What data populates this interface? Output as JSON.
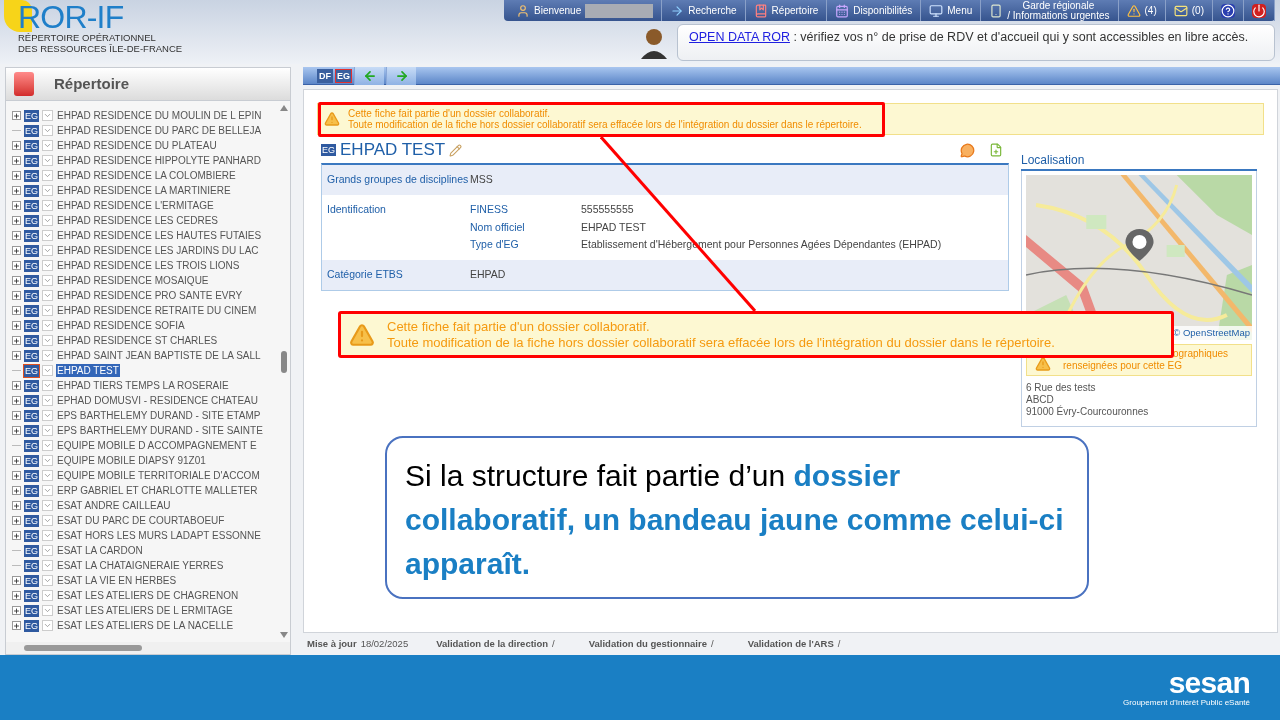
{
  "header": {
    "logo": "ROR-IF",
    "subtitle_lines": [
      "RÉPERTOIRE OPÉRATIONNEL",
      "DES RESSOURCES ÎLE-DE-FRANCE"
    ]
  },
  "nav": [
    {
      "kind": "user",
      "lines": [
        "Bienvenue"
      ]
    },
    {
      "kind": "search",
      "lines": [
        "Recherche"
      ]
    },
    {
      "kind": "directory",
      "lines": [
        "Répertoire"
      ]
    },
    {
      "kind": "availability",
      "lines": [
        "Disponibilités"
      ]
    },
    {
      "kind": "menu",
      "lines": [
        "Menu"
      ]
    },
    {
      "kind": "guard",
      "lines": [
        "Garde régionale",
        "/ Informations urgentes"
      ]
    },
    {
      "kind": "alert",
      "lines": [
        "(4)"
      ]
    },
    {
      "kind": "mail",
      "lines": [
        "(0)"
      ]
    },
    {
      "kind": "help"
    },
    {
      "kind": "power"
    }
  ],
  "notice": {
    "link": "OPEN DATA ROR",
    "text": " : vérifiez vos n° de prise de RDV et d'accueil qui y sont accessibles en libre accès."
  },
  "sidebar": {
    "title": "Répertoire",
    "items": [
      {
        "badge": "EG",
        "label": "EHPAD RESIDENCE DU MOULIN DE L EPIN",
        "expandable": true,
        "selected": false
      },
      {
        "badge": "EG",
        "label": "EHPAD RESIDENCE DU PARC DE BELLEJA",
        "expandable": false,
        "selected": false
      },
      {
        "badge": "EG",
        "label": "EHPAD RESIDENCE DU PLATEAU",
        "expandable": true,
        "selected": false
      },
      {
        "badge": "EG",
        "label": "EHPAD RESIDENCE HIPPOLYTE PANHARD",
        "expandable": true,
        "selected": false
      },
      {
        "badge": "EG",
        "label": "EHPAD RESIDENCE LA COLOMBIERE",
        "expandable": true,
        "selected": false
      },
      {
        "badge": "EG",
        "label": "EHPAD RESIDENCE LA MARTINIERE",
        "expandable": true,
        "selected": false
      },
      {
        "badge": "EG",
        "label": "EHPAD RESIDENCE L'ERMITAGE",
        "expandable": true,
        "selected": false
      },
      {
        "badge": "EG",
        "label": "EHPAD RESIDENCE LES CEDRES",
        "expandable": true,
        "selected": false
      },
      {
        "badge": "EG",
        "label": "EHPAD RESIDENCE LES HAUTES FUTAIES",
        "expandable": true,
        "selected": false
      },
      {
        "badge": "EG",
        "label": "EHPAD RESIDENCE LES JARDINS DU LAC",
        "expandable": true,
        "selected": false
      },
      {
        "badge": "EG",
        "label": "EHPAD RESIDENCE LES TROIS LIONS",
        "expandable": true,
        "selected": false
      },
      {
        "badge": "EG",
        "label": "EHPAD RESIDENCE MOSAIQUE",
        "expandable": true,
        "selected": false
      },
      {
        "badge": "EG",
        "label": "EHPAD RESIDENCE PRO SANTE EVRY",
        "expandable": true,
        "selected": false
      },
      {
        "badge": "EG",
        "label": "EHPAD RESIDENCE RETRAITE DU CINEM",
        "expandable": true,
        "selected": false
      },
      {
        "badge": "EG",
        "label": "EHPAD RESIDENCE SOFIA",
        "expandable": true,
        "selected": false
      },
      {
        "badge": "EG",
        "label": "EHPAD RESIDENCE ST CHARLES",
        "expandable": true,
        "selected": false
      },
      {
        "badge": "EG",
        "label": "EHPAD SAINT JEAN BAPTISTE DE LA SALL",
        "expandable": true,
        "selected": false
      },
      {
        "badge": "EG",
        "label": "EHPAD TEST",
        "expandable": false,
        "selected": true
      },
      {
        "badge": "EG",
        "label": "EHPAD TIERS TEMPS LA ROSERAIE",
        "expandable": true,
        "selected": false
      },
      {
        "badge": "EG",
        "label": "EPHAD DOMUSVI - RESIDENCE CHATEAU",
        "expandable": true,
        "selected": false
      },
      {
        "badge": "EG",
        "label": "EPS BARTHELEMY DURAND - SITE ETAMP",
        "expandable": true,
        "selected": false
      },
      {
        "badge": "EG",
        "label": "EPS BARTHELEMY DURAND - SITE SAINTE",
        "expandable": true,
        "selected": false
      },
      {
        "badge": "EG",
        "label": "EQUIPE MOBILE D ACCOMPAGNEMENT E",
        "expandable": false,
        "selected": false
      },
      {
        "badge": "EG",
        "label": "EQUIPE MOBILE DIAPSY 91Z01",
        "expandable": true,
        "selected": false
      },
      {
        "badge": "EG",
        "label": "EQUIPE MOBILE TERRITORIALE D'ACCOM",
        "expandable": true,
        "selected": false
      },
      {
        "badge": "EG",
        "label": "ERP GABRIEL ET CHARLOTTE MALLETER",
        "expandable": true,
        "selected": false
      },
      {
        "badge": "EG",
        "label": "ESAT ANDRE CAILLEAU",
        "expandable": true,
        "selected": false
      },
      {
        "badge": "EG",
        "label": "ESAT DU PARC DE COURTABOEUF",
        "expandable": true,
        "selected": false
      },
      {
        "badge": "EG",
        "label": "ESAT HORS LES MURS LADAPT ESSONNE",
        "expandable": true,
        "selected": false
      },
      {
        "badge": "EG",
        "label": "ESAT LA CARDON",
        "expandable": false,
        "selected": false
      },
      {
        "badge": "EG",
        "label": "ESAT LA CHATAIGNERAIE YERRES",
        "expandable": false,
        "selected": false
      },
      {
        "badge": "EG",
        "label": "ESAT LA VIE EN HERBES",
        "expandable": true,
        "selected": false
      },
      {
        "badge": "EG",
        "label": "ESAT LES ATELIERS DE CHAGRENON",
        "expandable": true,
        "selected": false
      },
      {
        "badge": "EG",
        "label": "ESAT LES ATELIERS DE L ERMITAGE",
        "expandable": true,
        "selected": false
      },
      {
        "badge": "EG",
        "label": "ESAT LES ATELIERS DE LA NACELLE",
        "expandable": true,
        "selected": false
      }
    ]
  },
  "toolbar": [
    {
      "kind": "text",
      "label": "DF",
      "selected": false
    },
    {
      "kind": "text",
      "label": "EG",
      "selected": true
    },
    {
      "kind": "back"
    },
    {
      "kind": "forward"
    }
  ],
  "banner": {
    "lines": [
      "Cette fiche fait partie d'un dossier collaboratif.",
      "Toute modification de la fiche hors dossier collaboratif sera effacée lors de l'intégration du dossier dans le répertoire."
    ]
  },
  "record": {
    "badge": "EG",
    "title": "EHPAD TEST",
    "rows": [
      {
        "label": "Grands groupes de disciplines",
        "fields": [
          {
            "value": "MSS"
          }
        ]
      },
      {
        "label": "Identification",
        "fields": [
          {
            "name": "FINESS",
            "value": "555555555"
          },
          {
            "name": "Nom officiel",
            "value": "EHPAD TEST"
          },
          {
            "name": "Type d'EG",
            "value": "Etablissement d'Hébergement pour Personnes Agées Dépendantes (EHPAD)"
          }
        ]
      },
      {
        "label": "Catégorie ETBS",
        "fields": [
          {
            "value": "EHPAD"
          }
        ]
      }
    ]
  },
  "location": {
    "title": "Localisation",
    "map_credit": "© OpenStreetMap",
    "warning_lines": [
      "ographiques",
      "renseignées pour cette EG"
    ],
    "address_lines": [
      "6 Rue des tests",
      "ABCD",
      "91000 Évry-Courcouronnes"
    ]
  },
  "footer": {
    "updated_label": "Mise à jour",
    "updated_value": "18/02/2025",
    "validations": [
      {
        "label": "Validation de la direction",
        "value": "/"
      },
      {
        "label": "Validation du gestionnaire",
        "value": "/"
      },
      {
        "label": "Validation de l'ARS",
        "value": "/"
      }
    ]
  },
  "callout": {
    "lines": [
      "Cette fiche fait partie d'un dossier collaboratif.",
      "Toute modification de la fiche hors dossier collaboratif sera effacée lors de l'intégration du dossier dans le répertoire."
    ]
  },
  "caption": "Si la structure fait partie d’un **dossier collaboratif, un bandeau jaune comme celui-ci apparaît.**",
  "brand": {
    "name": "sesan",
    "tagline": "Groupement d'Intérêt Public eSanté"
  }
}
